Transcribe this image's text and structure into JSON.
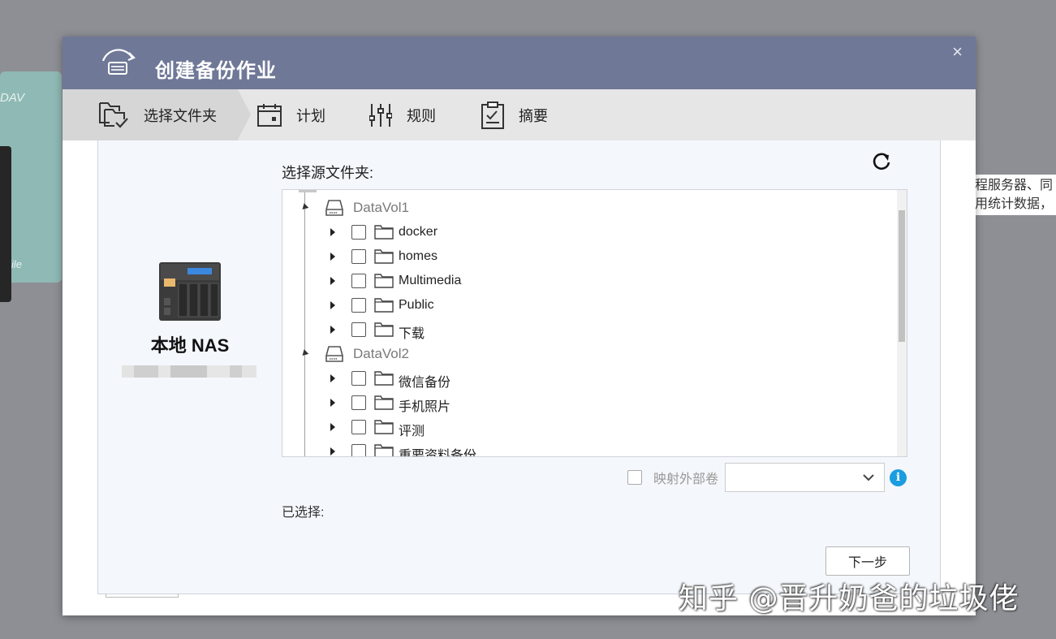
{
  "background": {
    "right_text_line1": "程服务器、同",
    "right_text_line2": "用统计数据，",
    "tile_labels": [
      "DAV",
      "ile"
    ]
  },
  "dialog": {
    "title": "创建备份作业",
    "close": "×"
  },
  "steps": [
    {
      "label": "选择文件夹",
      "icon": "folder-check-icon"
    },
    {
      "label": "计划",
      "icon": "calendar-icon"
    },
    {
      "label": "规则",
      "icon": "sliders-icon"
    },
    {
      "label": "摘要",
      "icon": "clipboard-icon"
    }
  ],
  "source": {
    "device_name": "本地 NAS",
    "select_label": "选择源文件夹:",
    "volumes": [
      {
        "name": "DataVol1",
        "folders": [
          "docker",
          "homes",
          "Multimedia",
          "Public",
          "下载"
        ]
      },
      {
        "name": "DataVol2",
        "folders": [
          "微信备份",
          "手机照片",
          "评测",
          "重要资料备份"
        ]
      }
    ]
  },
  "map_external": {
    "label": "映射外部卷",
    "selected": ""
  },
  "selected_label": "已选择:",
  "next_button": "下一步",
  "watermark": "知乎 @晋升奶爸的垃圾佬"
}
